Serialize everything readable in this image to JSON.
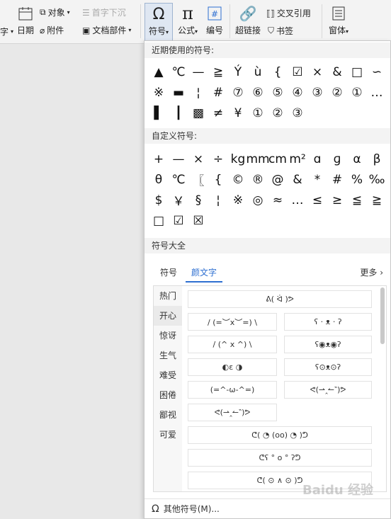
{
  "ribbon": {
    "left_cut": "字",
    "date": "日期",
    "object": "对象",
    "dropcap": "首字下沉",
    "attach": "附件",
    "docparts": "文档部件",
    "symbol": "符号",
    "formula": "公式",
    "numbering": "编号",
    "hyperlink": "超链接",
    "crossref": "交叉引用",
    "bookmark": "书签",
    "window": "窗体"
  },
  "panel": {
    "recent_title": "近期使用的符号:",
    "recent": [
      "▲",
      "℃",
      "—",
      "≧",
      "Ý",
      "ù",
      "{",
      "☑",
      "×",
      "&",
      "□",
      "∽",
      "※",
      "▬",
      "¦",
      "#",
      "⑦",
      "⑥",
      "⑤",
      "④",
      "③",
      "②",
      "①",
      "…",
      "▌",
      "┃",
      "▩",
      "≠",
      "¥",
      "①",
      "②",
      "③"
    ],
    "custom_title": "自定义符号:",
    "custom": [
      "+",
      "—",
      "×",
      "÷",
      "kg",
      "mm",
      "cm",
      "m²",
      "ɑ",
      "ɡ",
      "α",
      "β",
      "θ",
      "℃",
      "〖",
      "{",
      "©",
      "®",
      "@",
      "&",
      "*",
      "#",
      "%",
      "‰",
      "$",
      "￥",
      "§",
      "¦",
      "※",
      "◎",
      "≈",
      "…",
      "≤",
      "≥",
      "≦",
      "≧",
      "□",
      "☑",
      "☒"
    ],
    "all_title": "符号大全",
    "tab_symbol": "符号",
    "tab_kaomoji": "颜文字",
    "more": "更多 ›",
    "categories": [
      "热门",
      "开心",
      "惊讶",
      "生气",
      "难受",
      "困倦",
      "鄙视",
      "可爱"
    ],
    "emoticons": [
      "ᕕ( ᐛ )ᕗ",
      "/ (=︶x︶=) \\",
      "ʕ · ᴥ · ʔ",
      "/ (^ x ^) \\",
      "ʕ◉ᴥ◉ʔ",
      "◐ε ◑",
      "ʕ⊙ᴥ⊙ʔ",
      "(=^-ω-^=)",
      "ᕙ(⇀‸↼‶)ᕗ",
      "ᕙ(⇀‸↼‶)ᕗ",
      "ᕦ( ◔ (oo) ◔ )ᕤ",
      "ᕦʕ ° o ° ʔᕤ",
      "ᕦ( ⊙ ∧ ⊙ )ᕤ"
    ],
    "footer": "其他符号(M)...",
    "watermark": "Baidu 经验"
  }
}
